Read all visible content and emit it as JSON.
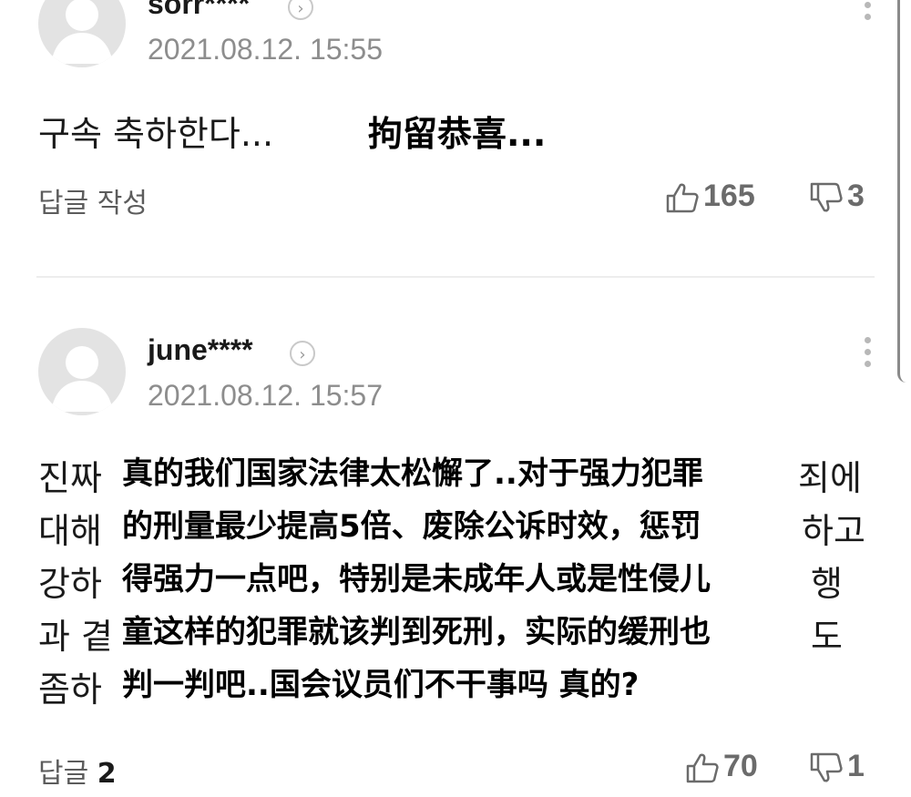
{
  "comments": [
    {
      "username": "sorr****",
      "timestamp": "2021.08.12. 15:55",
      "body": "구속 축하한다...",
      "translation": "拘留恭喜...",
      "reply_label": "답글 작성",
      "reply_count": "",
      "likes": "165",
      "dislikes": "3"
    },
    {
      "username": "june****",
      "timestamp": "2021.08.12. 15:57",
      "body_lines_left": [
        "진짜",
        "대해",
        "강하",
        "과 곁",
        "좀하"
      ],
      "body_lines_right": [
        "죄에",
        "하고",
        "행",
        "",
        "도"
      ],
      "translation_lines": [
        "真的我们国家法律太松懈了..对于强力犯罪",
        "的刑量最少提高5倍、废除公诉时效，惩罚",
        "得强力一点吧，特别是未成年人或是性侵儿",
        "童这样的犯罪就该判到死刑，实际的缓刑也",
        "判一判吧..国会议员们不干事吗 真的?"
      ],
      "reply_label": "답글",
      "reply_count": "2",
      "likes": "70",
      "dislikes": "1"
    }
  ],
  "colors": {
    "text": "#1a1a1a",
    "muted": "#8d8d8d",
    "vote": "#6b6b6b",
    "avatar_bg": "#e3e3e3"
  },
  "icons": [
    "avatar-placeholder-icon",
    "chevron-right-icon",
    "kebab-menu-icon",
    "thumbs-up-icon",
    "thumbs-down-icon"
  ]
}
